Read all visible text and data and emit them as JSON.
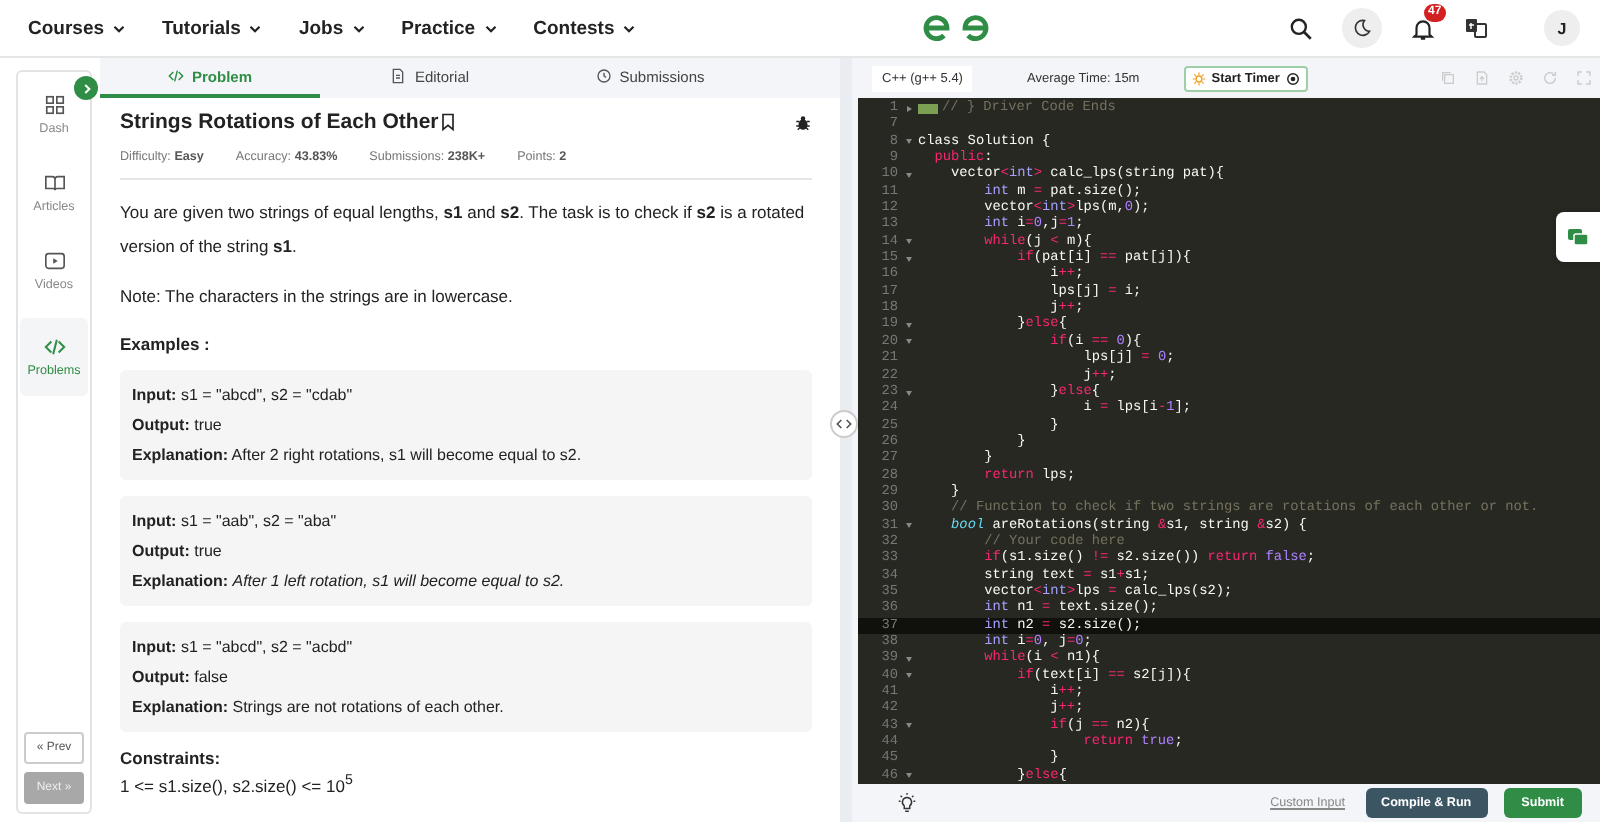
{
  "nav": {
    "menus": [
      "Courses",
      "Tutorials",
      "Jobs",
      "Practice",
      "Contests"
    ],
    "notification_count": "47",
    "avatar": "J"
  },
  "sidebar": {
    "items": [
      {
        "label": "Dash",
        "selected": false
      },
      {
        "label": "Articles",
        "selected": false
      },
      {
        "label": "Videos",
        "selected": false
      },
      {
        "label": "Problems",
        "selected": true
      }
    ],
    "prev": {
      "label": "« Prev",
      "disabled": false
    },
    "next": {
      "label": "Next »",
      "disabled": true
    }
  },
  "tabs": [
    {
      "label": "Problem",
      "selected": true
    },
    {
      "label": "Editorial",
      "selected": false
    },
    {
      "label": "Submissions",
      "selected": false
    }
  ],
  "problem": {
    "title": "Strings Rotations of Each Other",
    "meta": [
      {
        "label": "Difficulty:",
        "value": "Easy"
      },
      {
        "label": "Accuracy:",
        "value": "43.83%"
      },
      {
        "label": "Submissions:",
        "value": "238K+"
      },
      {
        "label": "Points:",
        "value": "2"
      }
    ],
    "paragraphs": [
      "You are given two strings of equal lengths, **s1** and **s2**. The task is to check if **s2** is a rotated version of the string **s1**.",
      "Note: The characters in the strings are in lowercase."
    ],
    "examples_heading": "Examples :",
    "examples": [
      {
        "input_label": "Input:",
        "input": "s1 = \"abcd\", s2 = \"cdab\"",
        "output_label": "Output:",
        "output": "true",
        "explanation_label": "Explanation:",
        "explanation": "After 2 right rotations, s1 will become equal to s2."
      },
      {
        "input_label": "Input:",
        "input": "s1 = \"aab\", s2 = \"aba\"",
        "output_label": "Output:",
        "output": "true",
        "explanation_label": "Explanation:",
        "explanation": "*After 1 left rotation, s1 will become equal to s2.*"
      },
      {
        "input_label": "Input:",
        "input": "s1 = \"abcd\", s2 = \"acbd\"",
        "output_label": "Output:",
        "output": "false",
        "explanation_label": "Explanation:",
        "explanation": "Strings are not rotations of each other."
      }
    ],
    "constraints_heading": "Constraints:",
    "constraints": "1 <= s1.size(), s2.size() <= 10$^{5}$"
  },
  "editor": {
    "language": "C++ (g++ 5.4)",
    "average_time": "Average Time: 15m",
    "timer_button": "Start Timer",
    "lines": [
      {
        "num": "1",
        "code": "// } Driver Code Ends",
        "kind": "folded",
        "current": false
      },
      {
        "num": "7",
        "kind": "plain",
        "current": false
      },
      {
        "num": "8",
        "code": "class Solution {",
        "kind": "foldable",
        "current": false
      },
      {
        "num": "9",
        "code": "  public:",
        "kind": "plain",
        "current": false
      },
      {
        "num": "10",
        "code": "    vector<int> calc_lps(string pat){",
        "kind": "foldable",
        "current": false
      },
      {
        "num": "11",
        "code": "        int m = pat.size();",
        "kind": "plain",
        "current": false
      },
      {
        "num": "12",
        "code": "        vector<int>lps(m,0);",
        "kind": "plain",
        "current": false
      },
      {
        "num": "13",
        "code": "        int i=0,j=1;",
        "kind": "plain",
        "current": false
      },
      {
        "num": "14",
        "code": "        while(j < m){",
        "kind": "foldable",
        "current": false
      },
      {
        "num": "15",
        "code": "            if(pat[i] == pat[j]){",
        "kind": "foldable",
        "current": false
      },
      {
        "num": "16",
        "code": "                i++;",
        "kind": "plain",
        "current": false
      },
      {
        "num": "17",
        "code": "                lps[j] = i;",
        "kind": "plain",
        "current": false
      },
      {
        "num": "18",
        "code": "                j++;",
        "kind": "plain",
        "current": false
      },
      {
        "num": "19",
        "code": "            }else{",
        "kind": "foldable",
        "current": false
      },
      {
        "num": "20",
        "code": "                if(i == 0){",
        "kind": "foldable",
        "current": false
      },
      {
        "num": "21",
        "code": "                    lps[j] = 0;",
        "kind": "plain",
        "current": false
      },
      {
        "num": "22",
        "code": "                    j++;",
        "kind": "plain",
        "current": false
      },
      {
        "num": "23",
        "code": "                }else{",
        "kind": "foldable",
        "current": false
      },
      {
        "num": "24",
        "code": "                    i = lps[i-1];",
        "kind": "plain",
        "current": false
      },
      {
        "num": "25",
        "code": "                }",
        "kind": "plain",
        "current": false
      },
      {
        "num": "26",
        "code": "            }",
        "kind": "plain",
        "current": false
      },
      {
        "num": "27",
        "code": "        }",
        "kind": "plain",
        "current": false
      },
      {
        "num": "28",
        "code": "        return lps;",
        "kind": "plain",
        "current": false
      },
      {
        "num": "29",
        "code": "    }",
        "kind": "plain",
        "current": false
      },
      {
        "num": "30",
        "code": "    // Function to check if two strings are rotations of each other or not.",
        "kind": "plain",
        "current": false
      },
      {
        "num": "31",
        "code": "    bool areRotations(string &s1, string &s2) {",
        "kind": "foldable",
        "current": false
      },
      {
        "num": "32",
        "code": "        // Your code here",
        "kind": "plain",
        "current": false
      },
      {
        "num": "33",
        "code": "        if(s1.size() != s2.size()) return false;",
        "kind": "plain",
        "current": false
      },
      {
        "num": "34",
        "code": "        string text = s1+s1;",
        "kind": "plain",
        "current": false
      },
      {
        "num": "35",
        "code": "        vector<int>lps = calc_lps(s2);",
        "kind": "plain",
        "current": false
      },
      {
        "num": "36",
        "code": "        int n1 = text.size();",
        "kind": "plain",
        "current": false
      },
      {
        "num": "37",
        "code": "        int n2 = s2.size();",
        "kind": "plain",
        "current": true
      },
      {
        "num": "38",
        "code": "        int i=0, j=0;",
        "kind": "plain",
        "current": false
      },
      {
        "num": "39",
        "code": "        while(i < n1){",
        "kind": "foldable",
        "current": false
      },
      {
        "num": "40",
        "code": "            if(text[i] == s2[j]){",
        "kind": "foldable",
        "current": false
      },
      {
        "num": "41",
        "code": "                i++;",
        "kind": "plain",
        "current": false
      },
      {
        "num": "42",
        "code": "                j++;",
        "kind": "plain",
        "current": false
      },
      {
        "num": "43",
        "code": "                if(j == n2){",
        "kind": "foldable",
        "current": false
      },
      {
        "num": "44",
        "code": "                    return true;",
        "kind": "plain",
        "current": false
      },
      {
        "num": "45",
        "code": "                }",
        "kind": "plain",
        "current": false
      },
      {
        "num": "46",
        "code": "            }else{",
        "kind": "foldable",
        "current": false
      }
    ],
    "custom_input": "Custom Input",
    "compile_button": "Compile & Run",
    "submit_button": "Submit"
  }
}
